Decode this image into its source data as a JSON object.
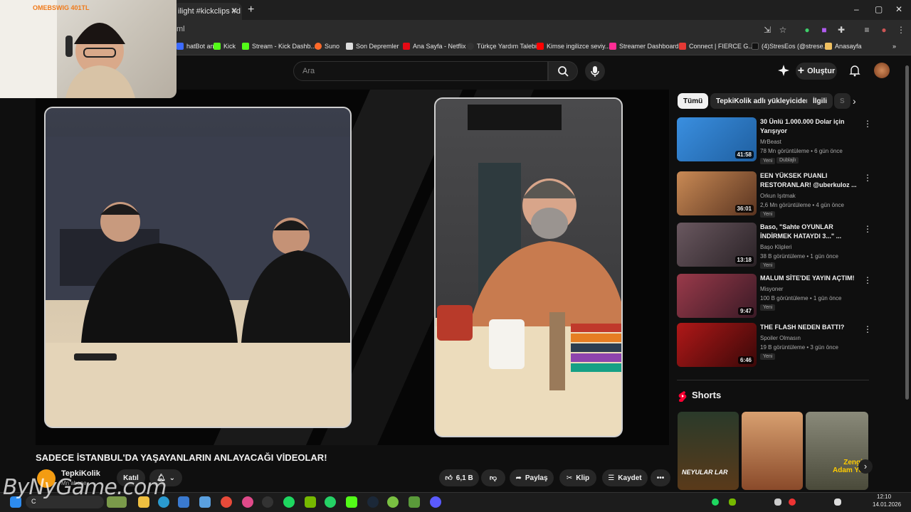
{
  "browser": {
    "tab_title": "ilight #kickclips #d",
    "new_tab": "+",
    "url": "ml",
    "window_controls": [
      "–",
      "▢",
      "✕"
    ],
    "bookmarks": [
      {
        "label": "hatBot an...",
        "color": "#3d6bff"
      },
      {
        "label": "Kick",
        "color": "#53fc18"
      },
      {
        "label": "Stream - Kick Dashb...",
        "color": "#53fc18"
      },
      {
        "label": "Suno",
        "color": "#ff6a2a"
      },
      {
        "label": "Son Depremler",
        "color": "#dddddd"
      },
      {
        "label": "Ana Sayfa - Netflix",
        "color": "#e50914"
      },
      {
        "label": "Türkçe Yardım Talebi",
        "color": "#222222"
      },
      {
        "label": "Kimse ingilizce seviy...",
        "color": "#ff0000"
      },
      {
        "label": "Streamer Dashboard",
        "color": "#ff2d95"
      },
      {
        "label": "Connect | FIERCE G...",
        "color": "#e53935"
      },
      {
        "label": "(4)StresEos (@strese...",
        "color": "#111111"
      },
      {
        "label": "Anasayfa",
        "color": "#f0c060"
      }
    ]
  },
  "youtube": {
    "search_placeholder": "Ara",
    "create_label": "Oluştur",
    "video_title": "SADECE İSTANBUL'DA YAŞAYANLARIN ANLAYACAĞI VİDEOLAR!",
    "channel_name": "TepkiKolik",
    "channel_subs": "Mn abone",
    "join_label": "Katıl",
    "likes": "6,1 B",
    "share_label": "Paylaş",
    "clip_label": "Klip",
    "save_label": "Kaydet",
    "more_label": "•••",
    "chips": [
      "Tümü",
      "TepkiKolik adlı yükleyiciden",
      "İlgili",
      "S"
    ],
    "recommendations": [
      {
        "title": "30 Ünlü 1.000.000 Dolar için Yarışıyor",
        "channel": "MrBeast",
        "meta": "78 Mn görüntüleme • 6 gün önce",
        "badge": "Yeni",
        "extra": "Dublajlı",
        "duration": "41:58",
        "color": "#2f7fcf"
      },
      {
        "title": "EEN YÜKSEK PUANLI RESTORANLAR! @uberkuloz ...",
        "channel": "Orkun Işıtmak",
        "meta": "2,6 Mn görüntüleme • 4 gün önce",
        "badge": "Yeni",
        "extra": "",
        "duration": "36:01",
        "color": "#a86a3d"
      },
      {
        "title": "Baso, \"Sahte OYUNLAR İNDİRMEK HATAYDI 3...\" ...",
        "channel": "Başo Klipleri",
        "meta": "38 B görüntüleme • 1 gün önce",
        "badge": "Yeni",
        "extra": "",
        "duration": "13:18",
        "color": "#5a4a52"
      },
      {
        "title": "MALUM SİTE'DE YAYIN AÇTIM!",
        "channel": "Misyoner",
        "meta": "100 B görüntüleme • 1 gün önce",
        "badge": "Yeni",
        "extra": "",
        "duration": "9:47",
        "color": "#7a2a3a"
      },
      {
        "title": "THE FLASH NEDEN BATTI?",
        "channel": "Spoiler Olmasın",
        "meta": "19 B görüntüleme • 3 gün önce",
        "badge": "Yeni",
        "extra": "",
        "duration": "6:46",
        "color": "#8a1010"
      }
    ],
    "shorts_title": "Shorts",
    "shorts": [
      {
        "caption": "NEYULAR LAR",
        "color": "#3a3a2a"
      },
      {
        "caption": "",
        "color": "#c06a3a"
      },
      {
        "caption": "Zengin Adam Yok",
        "color": "#6a6a5a"
      }
    ]
  },
  "overlay": {
    "cam_text": "OMEBSWIG 401TL",
    "watermark": "ByNyGame.com"
  },
  "taskbar": {
    "search_text": "C",
    "time": "12:10",
    "date": "14.01.2026"
  }
}
